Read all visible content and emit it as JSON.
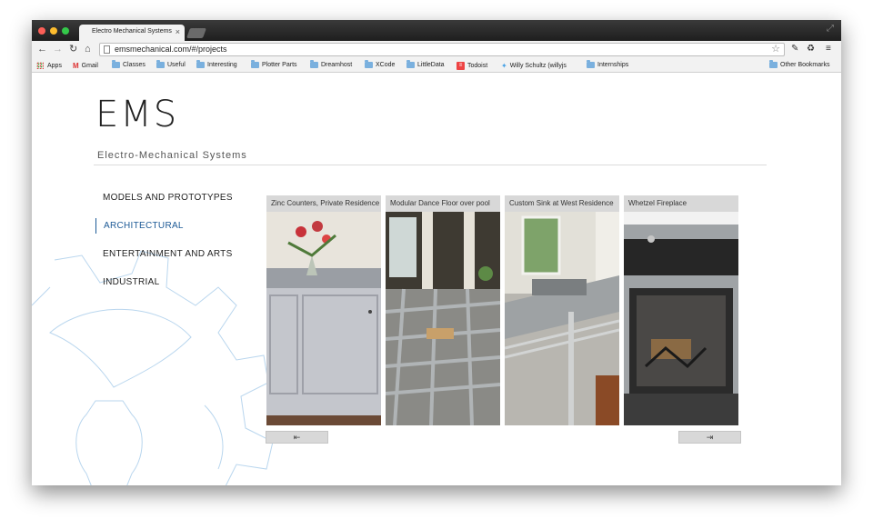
{
  "browser": {
    "tab_title": "Electro Mechanical Systems",
    "tab_close": "×",
    "url": "emsmechanical.com/#/projects",
    "bookmarks": [
      {
        "label": "Apps",
        "icon": "apps-grid-icon"
      },
      {
        "label": "Gmail",
        "icon": "gmail-icon"
      },
      {
        "label": "Classes",
        "icon": "folder-icon"
      },
      {
        "label": "Useful",
        "icon": "folder-icon"
      },
      {
        "label": "Interesting",
        "icon": "folder-icon"
      },
      {
        "label": "Plotter Parts",
        "icon": "folder-icon"
      },
      {
        "label": "Dreamhost",
        "icon": "folder-icon"
      },
      {
        "label": "XCode",
        "icon": "folder-icon"
      },
      {
        "label": "LittleData",
        "icon": "folder-icon"
      },
      {
        "label": "Todoist",
        "icon": "todoist-icon"
      },
      {
        "label": "Willy Schultz (willyjs",
        "icon": "twitter-icon"
      },
      {
        "label": "Internships",
        "icon": "folder-icon"
      }
    ],
    "other_bookmarks": "Other Bookmarks"
  },
  "site": {
    "logo": "EMS",
    "subtitle": "Electro-Mechanical Systems",
    "categories": [
      {
        "label": "MODELS AND PROTOTYPES",
        "active": false
      },
      {
        "label": "ARCHITECTURAL",
        "active": true
      },
      {
        "label": "ENTERTAINMENT AND ARTS",
        "active": false
      },
      {
        "label": "INDUSTRIAL",
        "active": false
      }
    ],
    "projects": [
      {
        "title": "Zinc Counters, Private Residence"
      },
      {
        "title": "Modular Dance Floor over pool"
      },
      {
        "title": "Custom Sink at West Residence"
      },
      {
        "title": "Whetzel Fireplace"
      }
    ],
    "pager_prev": "⇤",
    "pager_next": "⇥"
  },
  "colors": {
    "active_category": "#1d5a96",
    "gear_outline": "#b9d6ee"
  }
}
